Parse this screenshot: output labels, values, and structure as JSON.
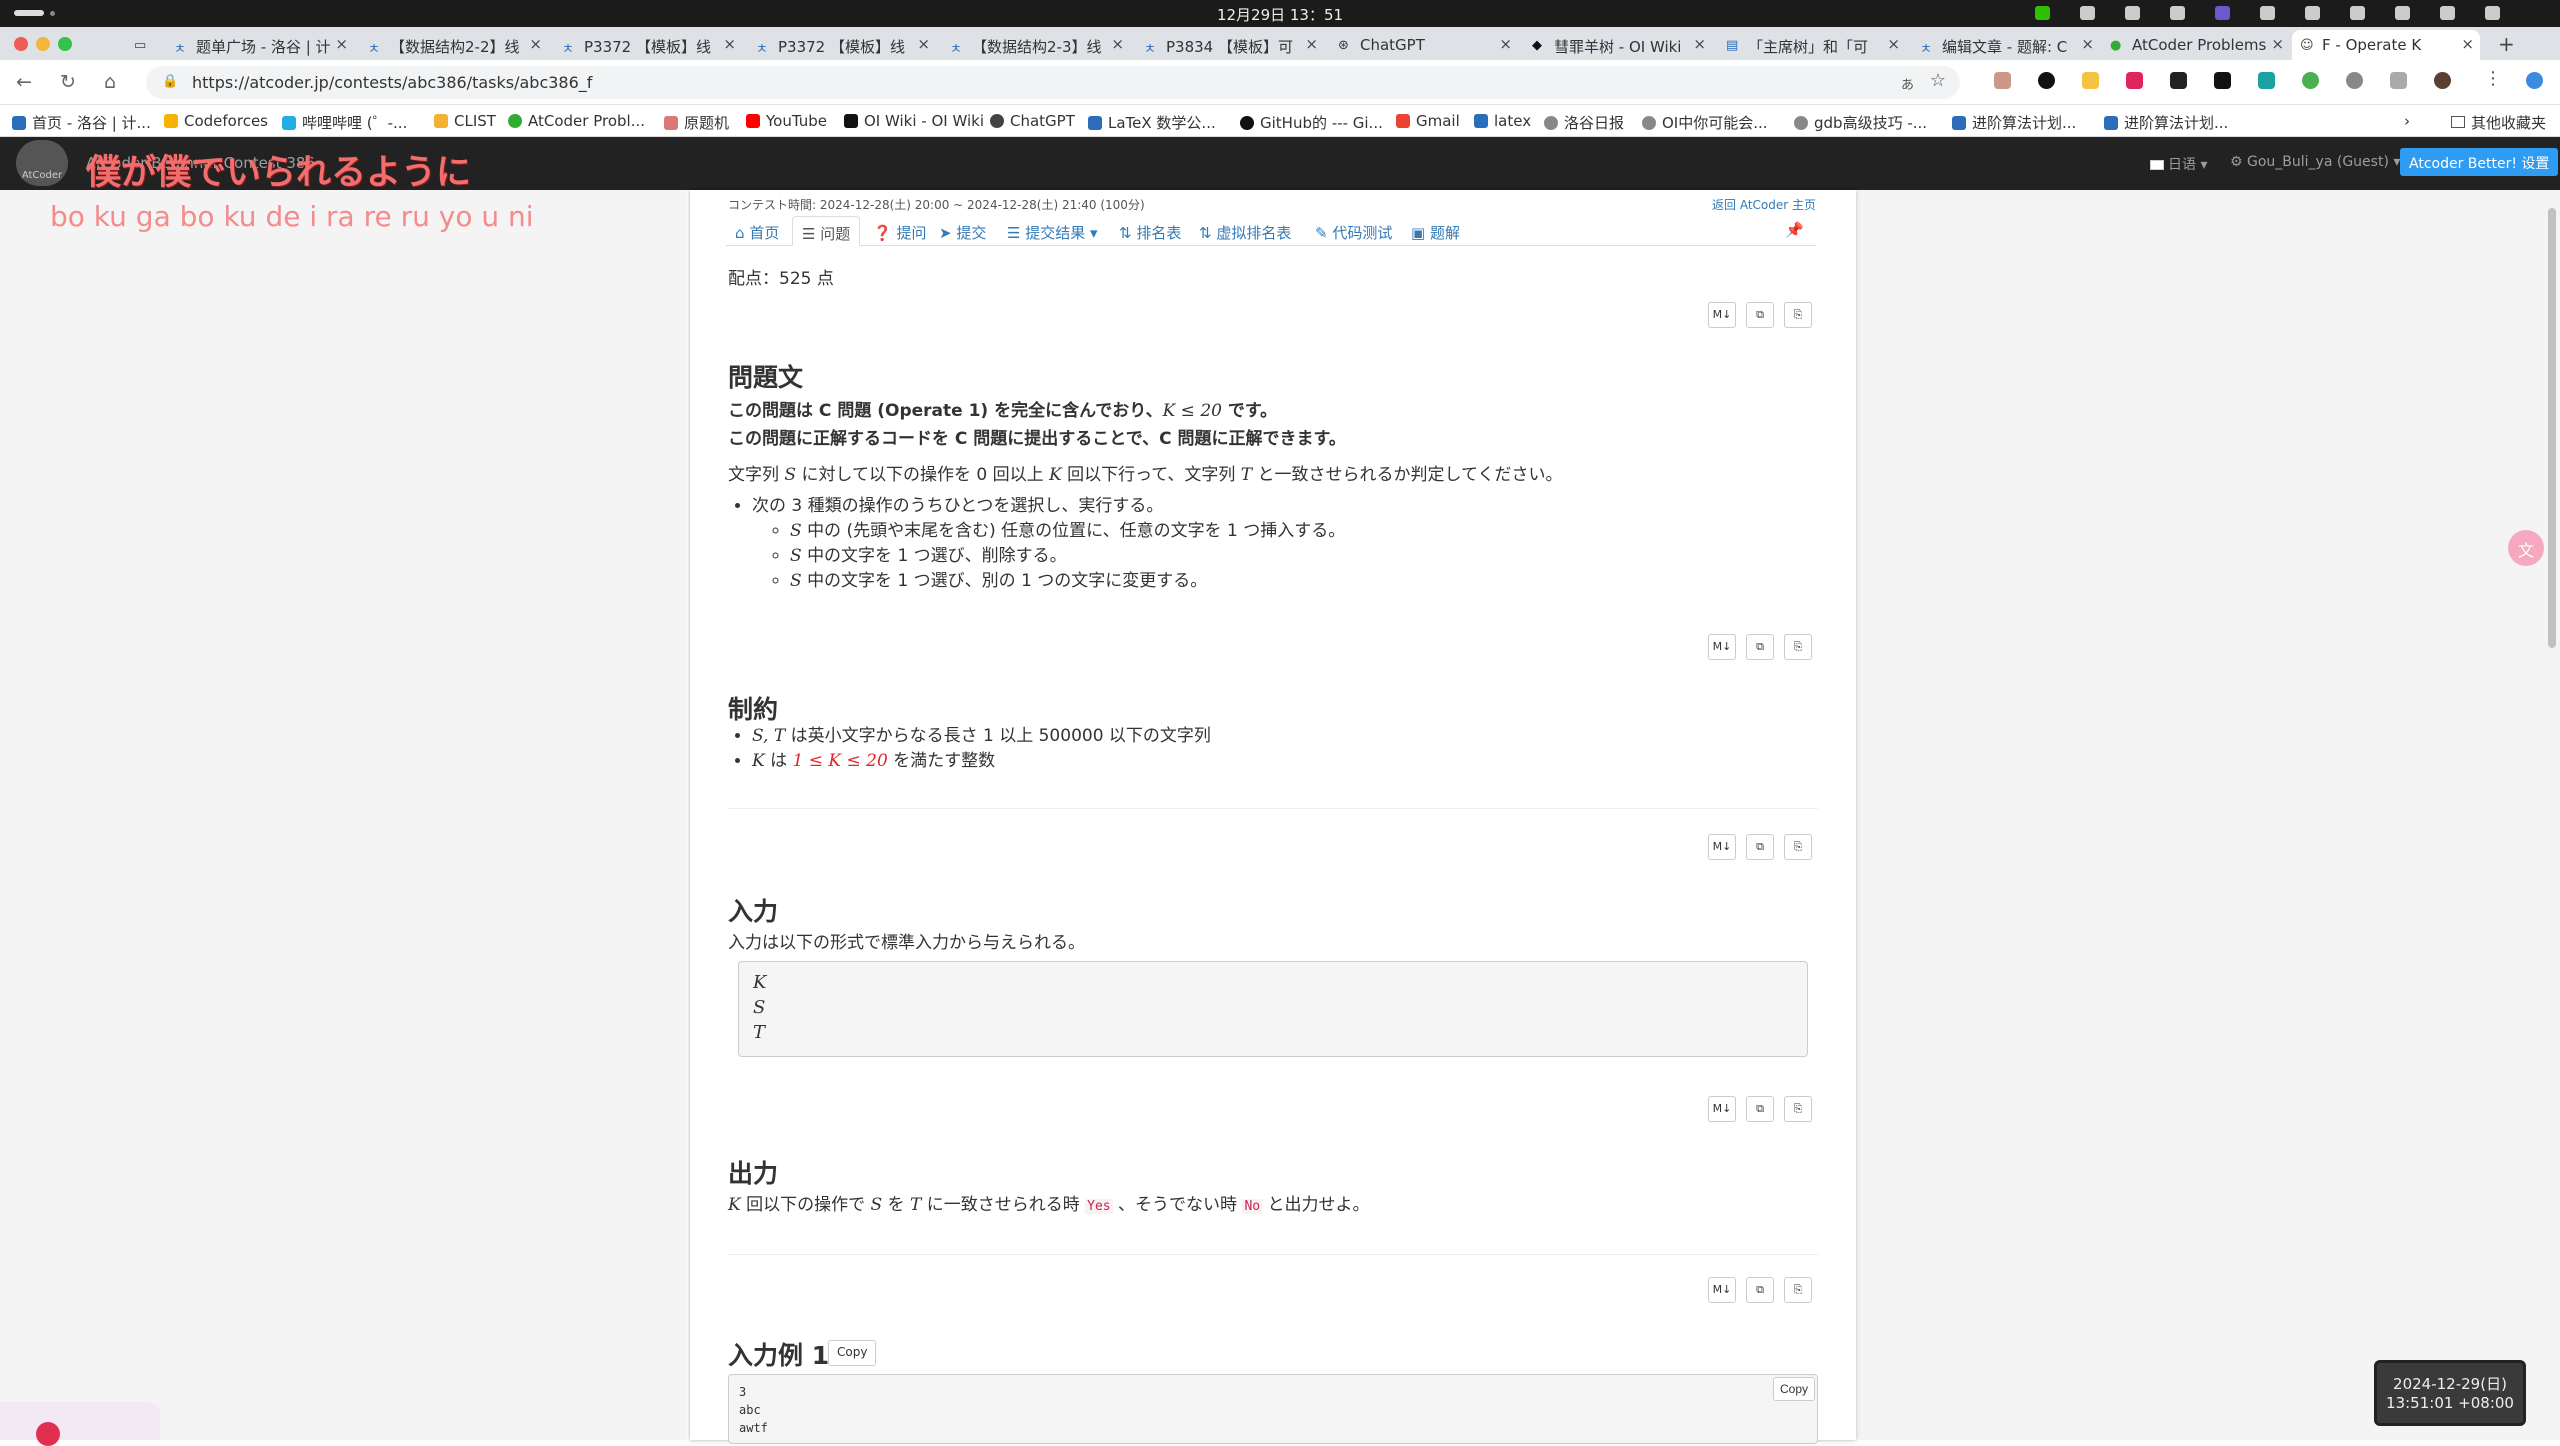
{
  "os": {
    "clock": "12月29日 13：51"
  },
  "browser": {
    "tabs": [
      {
        "title": "题单广场 - 洛谷 | 计"
      },
      {
        "title": "【数据结构2-2】线"
      },
      {
        "title": "P3372 【模板】线"
      },
      {
        "title": "P3372 【模板】线"
      },
      {
        "title": "【数据结构2-3】线"
      },
      {
        "title": "P3834 【模板】可"
      },
      {
        "title": "ChatGPT"
      },
      {
        "title": "彗罪羊树 - OI Wiki"
      },
      {
        "title": "「主席树」和「可"
      },
      {
        "title": "编辑文章 - 题解: C"
      },
      {
        "title": "AtCoder Problems"
      },
      {
        "title": "F - Operate K"
      }
    ],
    "new_tab": "+",
    "url": "https://atcoder.jp/contests/abc386/tasks/abc386_f",
    "bookmarks": [
      "首页 - 洛谷 | 计...",
      "Codeforces",
      "哔哩哔哩 (゜-...",
      "CLIST",
      "AtCoder Probl...",
      "原题机",
      "YouTube",
      "OI Wiki - OI Wiki",
      "ChatGPT",
      "LaTeX 数学公...",
      "GitHub的 --- Gi...",
      "Gmail",
      "latex",
      "洛谷日报",
      "OI中你可能会...",
      "gdb高级技巧 -...",
      "进阶算法计划...",
      "进阶算法计划..."
    ],
    "bookmarks_more": "其他收藏夹"
  },
  "site": {
    "contest_name": "AtCoder Beginner Contest 386",
    "lyric_jp": "僕が僕でいられるように",
    "lyric_romaji": "bo ku ga bo ku de i ra re ru yo u ni",
    "lang": "日语",
    "user": "Gou_Buli_ya (Guest)",
    "atcoder_better": "Atcoder Better! 设置",
    "logo_text": "AtCoder",
    "contest_time": "コンテスト時間: 2024-12-28(土) 20:00 ~ 2024-12-28(土) 21:40 (100分)",
    "back_home": "返回 AtCoder 主页",
    "tabs": [
      "首页",
      "问题",
      "提问",
      "提交",
      "提交结果",
      "排名表",
      "虚拟排名表",
      "代码测试",
      "题解"
    ],
    "score": "配点：525 点",
    "btn_labels": [
      "M↓",
      "⧉",
      "⎘"
    ]
  },
  "problem": {
    "h_statement": "問題文",
    "note1": "この問題は C 問題 (Operate 1) を完全に含んでおり、",
    "note1_math": "K ≤ 20",
    "note1_end": " です。",
    "note2": "この問題に正解するコードを C 問題に提出することで、C 問題に正解できます。",
    "p1_a": "文字列 ",
    "p1_S": "S",
    "p1_b": " に対して以下の操作を 0 回以上 ",
    "p1_K": "K",
    "p1_c": " 回以下行って、文字列 ",
    "p1_T": "T",
    "p1_d": " と一致させられるか判定してください。",
    "op_intro": "次の 3 種類の操作のうちひとつを選択し、実行する。",
    "ops": [
      "中の (先頭や末尾を含む) 任意の位置に、任意の文字を 1 つ挿入する。",
      "中の文字を 1 つ選び、削除する。",
      "中の文字を 1 つ選び、別の 1 つの文字に変更する。"
    ],
    "op_var": "S",
    "h_constraints": "制約",
    "c1_math": "S, T",
    "c1_text": " は英小文字からなる長さ 1 以上 500000 以下の文字列",
    "c2_math": "K",
    "c2_a": " は ",
    "c2_red": "1 ≤ K ≤ 20",
    "c2_b": " を満たす整数",
    "h_input": "入力",
    "input_text": "入力は以下の形式で標準入力から与えられる。",
    "input_format": [
      "K",
      "S",
      "T"
    ],
    "h_output": "出力",
    "out_K": "K",
    "out_a": " 回以下の操作で ",
    "out_S": "S",
    "out_b": " を ",
    "out_T": "T",
    "out_c": " に一致させられる時 ",
    "out_yes": "Yes",
    "out_d": " 、そうでない時 ",
    "out_no": "No",
    "out_e": " と出力せよ。",
    "h_sample1": "入力例 1",
    "copy": "Copy",
    "sample1": [
      "3",
      "abc",
      "awtf"
    ]
  },
  "datetime": {
    "date": "2024-12-29(日)",
    "time": "13:51:01 +08:00"
  },
  "translate_icon": "文"
}
